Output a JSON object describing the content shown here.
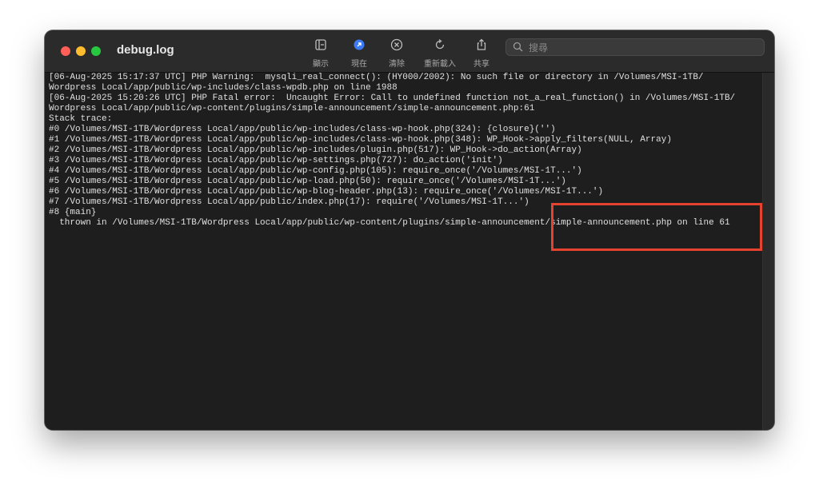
{
  "window": {
    "title": "debug.log"
  },
  "toolbar": {
    "show_label": "顯示",
    "now_label": "現在",
    "clear_label": "清除",
    "reload_label": "重新載入",
    "share_label": "共享"
  },
  "search": {
    "placeholder": "搜尋",
    "value": ""
  },
  "log": {
    "lines": [
      "[06-Aug-2025 15:17:37 UTC] PHP Warning:  mysqli_real_connect(): (HY000/2002): No such file or directory in /Volumes/MSI-1TB/",
      "Wordpress Local/app/public/wp-includes/class-wpdb.php on line 1988",
      "[06-Aug-2025 15:20:26 UTC] PHP Fatal error:  Uncaught Error: Call to undefined function not_a_real_function() in /Volumes/MSI-1TB/",
      "Wordpress Local/app/public/wp-content/plugins/simple-announcement/simple-announcement.php:61",
      "Stack trace:",
      "#0 /Volumes/MSI-1TB/Wordpress Local/app/public/wp-includes/class-wp-hook.php(324): {closure}('')",
      "#1 /Volumes/MSI-1TB/Wordpress Local/app/public/wp-includes/class-wp-hook.php(348): WP_Hook->apply_filters(NULL, Array)",
      "#2 /Volumes/MSI-1TB/Wordpress Local/app/public/wp-includes/plugin.php(517): WP_Hook->do_action(Array)",
      "#3 /Volumes/MSI-1TB/Wordpress Local/app/public/wp-settings.php(727): do_action('init')",
      "#4 /Volumes/MSI-1TB/Wordpress Local/app/public/wp-config.php(105): require_once('/Volumes/MSI-1T...')",
      "#5 /Volumes/MSI-1TB/Wordpress Local/app/public/wp-load.php(50): require_once('/Volumes/MSI-1T...')",
      "#6 /Volumes/MSI-1TB/Wordpress Local/app/public/wp-blog-header.php(13): require_once('/Volumes/MSI-1T...')",
      "#7 /Volumes/MSI-1TB/Wordpress Local/app/public/index.php(17): require('/Volumes/MSI-1T...')",
      "#8 {main}",
      "  thrown in /Volumes/MSI-1TB/Wordpress Local/app/public/wp-content/plugins/simple-announcement/simple-announcement.php on line 61"
    ]
  },
  "colors": {
    "highlight_box": "#e5432f",
    "log_background": "#1e1e1e",
    "log_text": "#e0e0e0",
    "now_icon_accent": "#3d7bf5"
  }
}
